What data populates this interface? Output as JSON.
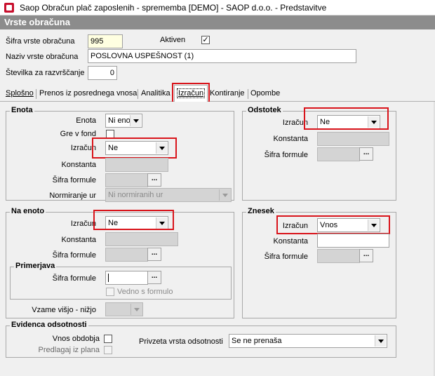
{
  "window": {
    "title": "Saop Obračun plač zaposlenih - sprememba [DEMO] - SAOP d.o.o. - Predstavitve"
  },
  "header": {
    "title": "Vrste obračuna"
  },
  "form": {
    "sifra_label": "Šifra vrste obračuna",
    "sifra_value": "995",
    "aktiven_label": "Aktiven",
    "aktiven_checked": "✓",
    "naziv_label": "Naziv vrste obračuna",
    "naziv_value": "POSLOVNA USPEŠNOST (1)",
    "stevilka_label": "Številka  za razvrščanje",
    "stevilka_value": "0"
  },
  "tabs": [
    {
      "label": "Splošno"
    },
    {
      "label": "Prenos iz posrednega vnosa"
    },
    {
      "label": "Analitika"
    },
    {
      "label": "Izračun"
    },
    {
      "label": "Kontiranje"
    },
    {
      "label": "Opombe"
    }
  ],
  "enota": {
    "title": "Enota",
    "enota_label": "Enota",
    "enota_value": "Ni enot",
    "gre_v_fond_label": "Gre v fond",
    "izracun_label": "Izračun",
    "izracun_value": "Ne",
    "konstanta_label": "Konstanta",
    "sifra_formule_label": "Šifra formule",
    "normiranje_label": "Normiranje ur",
    "normiranje_value": "Ni normiranih ur"
  },
  "odstotek": {
    "title": "Odstotek",
    "izracun_label": "Izračun",
    "izracun_value": "Ne",
    "konstanta_label": "Konstanta",
    "sifra_formule_label": "Šifra formule"
  },
  "na_enoto": {
    "title": "Na enoto",
    "izracun_label": "Izračun",
    "izracun_value": "Ne",
    "konstanta_label": "Konstanta",
    "sifra_formule_label": "Šifra formule",
    "primerjava_title": "Primerjava",
    "primerjava_sifra_label": "Šifra formule",
    "vedno_label": "Vedno s formulo",
    "vzame_label": "Vzame višjo - nižjo"
  },
  "znesek": {
    "title": "Znesek",
    "izracun_label": "Izračun",
    "izracun_value": "Vnos",
    "konstanta_label": "Konstanta",
    "sifra_formule_label": "Šifra formule"
  },
  "evidenca": {
    "title": "Evidenca odsotnosti",
    "vnos_label": "Vnos obdobja",
    "predlagaj_label": "Predlagaj iz plana",
    "privzeta_label": "Privzeta vrsta odsotnosti",
    "privzeta_value": "Se ne prenaša"
  },
  "dots": "...",
  "colors": {
    "header_bg": "#8c8c8c",
    "highlight": "#d9141b",
    "yellow_input": "#ffffe1"
  }
}
